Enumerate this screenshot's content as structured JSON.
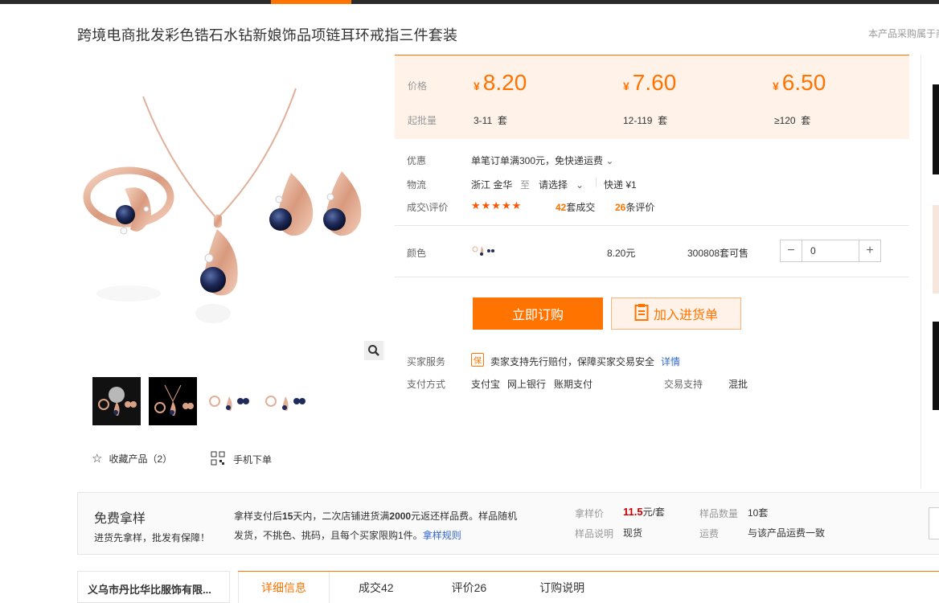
{
  "page": {
    "title": "跨境电商批发彩色锆石水钻新娘饰品项链耳环戒指三件套装",
    "notice": "本产品采购属于商"
  },
  "gallery": {
    "thumbnail_count": 4,
    "favorite_label": "收藏产品（2）",
    "mobile_order_label": "手机下单"
  },
  "price_box": {
    "price_label": "价格",
    "moq_label": "起批量",
    "currency_symbol": "¥",
    "tiers": [
      {
        "price": "8.20",
        "range": "3-11",
        "unit": "套"
      },
      {
        "price": "7.60",
        "range": "12-119",
        "unit": "套"
      },
      {
        "price": "6.50",
        "range": "≥120",
        "unit": "套"
      }
    ]
  },
  "details": {
    "promo_label": "优惠",
    "promo_value": "单笔订单满300元，免快递运费",
    "logistics_label": "物流",
    "origin": "浙江 金华",
    "to": "至",
    "destination": "请选择",
    "express": "快递 ¥1",
    "deals_label": "成交\\评价",
    "stars": "★★★★★",
    "deals_count": "42",
    "deals_suffix": "套成交",
    "review_count": "26",
    "review_suffix": "条评价"
  },
  "sku": {
    "color_label": "颜色",
    "price": "8.20元",
    "stock": "300808套可售",
    "quantity": "0",
    "minus": "−",
    "plus": "+"
  },
  "actions": {
    "buy_now": "立即订购",
    "add_to_cart": "加入进货单"
  },
  "services": {
    "buyer_service_label": "买家服务",
    "buyer_service_badge": "保",
    "buyer_service_text": "卖家支持先行赔付，保障买家交易安全",
    "buyer_service_link": "详情",
    "payment_label": "支付方式",
    "payments": [
      "支付宝",
      "网上银行",
      "账期支付"
    ],
    "trade_support_label": "交易支持",
    "trade_support_value": "混批"
  },
  "sample": {
    "title": "免费拿样",
    "subtitle": "进货先拿样，批发有保障！",
    "desc_1": "拿样支付后",
    "desc_days": "15",
    "desc_2": "天内，二次店铺进货满",
    "desc_amount": "2000",
    "desc_3": "元返还样品费。样品随机发货，不挑色、挑码，且每个买家限购1件。",
    "rules_link": "拿样规则",
    "sample_price_label": "拿样价",
    "sample_price": "11.5",
    "sample_price_unit": "元/套",
    "sample_qty_label": "样品数量",
    "sample_qty": "10套",
    "sample_note_label": "样品说明",
    "sample_note": "现货",
    "shipping_label": "运费",
    "shipping_value": "与该产品运费一致"
  },
  "bottom": {
    "company": "义乌市丹比华比服饰有限...",
    "tabs": [
      "详细信息",
      "成交42",
      "评价26",
      "订购说明"
    ]
  },
  "colors": {
    "accent": "#ff7300",
    "price_bg": "#fff2e8",
    "link": "#3366cc",
    "star": "#ff5500"
  }
}
